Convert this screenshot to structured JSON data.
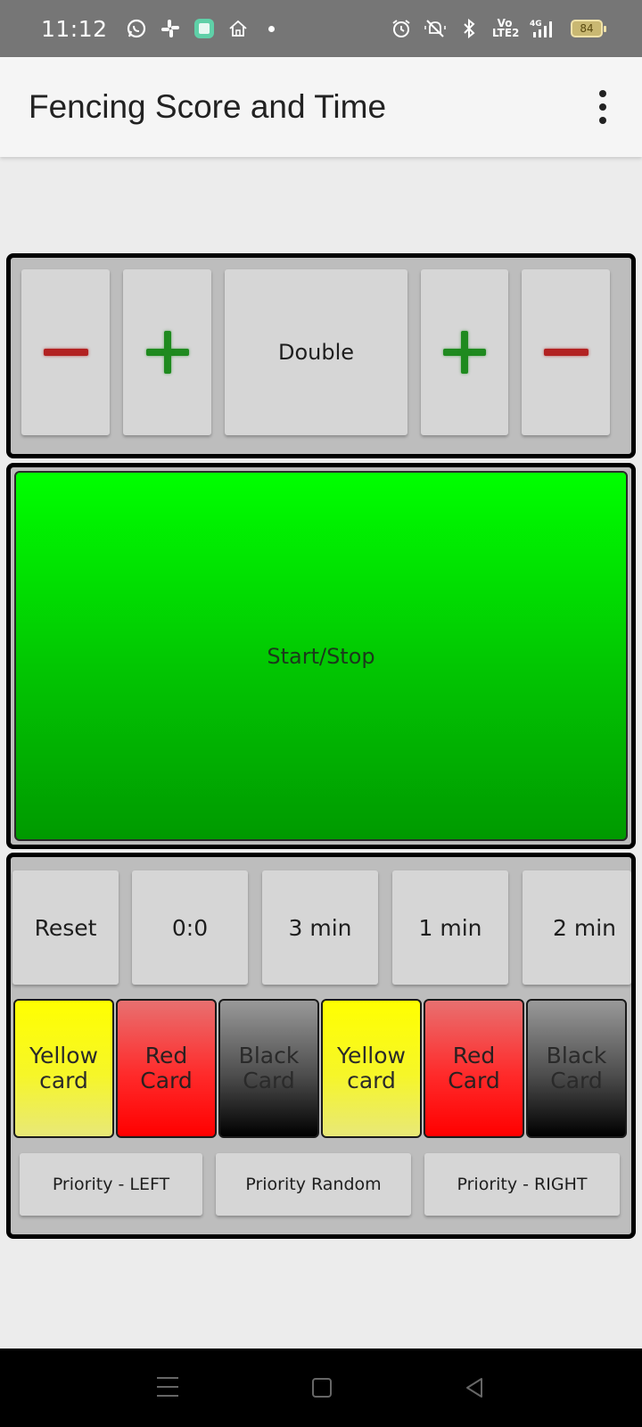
{
  "status_bar": {
    "time": "11:12",
    "network": "4G",
    "volte": "Vo LTE2",
    "battery": "84"
  },
  "app_bar": {
    "title": "Fencing Score and Time"
  },
  "score_panel": {
    "double_label": "Double"
  },
  "timer_panel": {
    "start_stop_label": "Start/Stop"
  },
  "time_buttons": [
    "Reset",
    "0:0",
    "3 min",
    "1 min",
    "2 min"
  ],
  "cards": [
    {
      "line1": "Yellow",
      "line2": "card"
    },
    {
      "line1": "Red",
      "line2": "Card"
    },
    {
      "line1": "Black",
      "line2": "Card"
    },
    {
      "line1": "Yellow",
      "line2": "card"
    },
    {
      "line1": "Red",
      "line2": "Card"
    },
    {
      "line1": "Black",
      "line2": "Card"
    }
  ],
  "priority_buttons": [
    "Priority - LEFT",
    "Priority Random",
    "Priority - RIGHT"
  ],
  "colors": {
    "start_stop_green": "#00ff00",
    "minus_red": "#b22222",
    "plus_green": "#1f8a1f",
    "yellow_card": "#ffff00",
    "red_card": "#ff0000",
    "black_card": "#000000"
  }
}
